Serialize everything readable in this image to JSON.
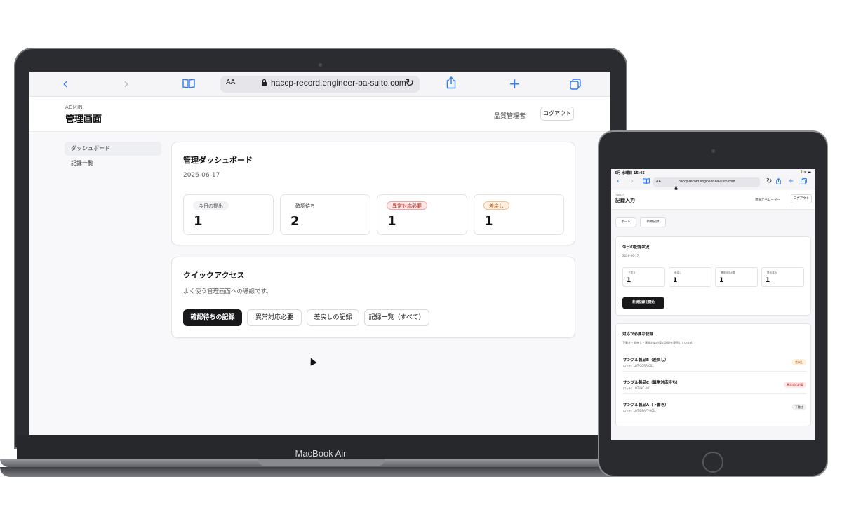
{
  "laptop": {
    "label": "MacBook Air",
    "browser": {
      "text_size": "AA",
      "url": "haccp-record.engineer-ba-sulto.com"
    },
    "header": {
      "eyebrow": "ADMIN",
      "title": "管理画面",
      "user": "品質管理者",
      "logout": "ログアウト"
    },
    "sidebar": {
      "items": [
        {
          "label": "ダッシュボード",
          "active": true
        },
        {
          "label": "記録一覧",
          "active": false
        }
      ]
    },
    "dashboard": {
      "title": "管理ダッシュボード",
      "date": "2026-06-17",
      "stats": [
        {
          "label": "今日の提出",
          "value": "1",
          "bg": "#f2f2f4",
          "fg": "#555555",
          "border": "#f2f2f4"
        },
        {
          "label": "確認待ち",
          "value": "2",
          "bg": "#ffffff",
          "fg": "#333333",
          "border": "#ffffff"
        },
        {
          "label": "異常対応必要",
          "value": "1",
          "bg": "#fde6e6",
          "fg": "#b42318",
          "border": "#f3a3a3"
        },
        {
          "label": "差戻し",
          "value": "1",
          "bg": "#fff0e0",
          "fg": "#b45309",
          "border": "#f5c089"
        }
      ]
    },
    "quick_access": {
      "title": "クイックアクセス",
      "subtitle": "よく使う管理画面への導線です。",
      "buttons": [
        {
          "label": "確認待ちの記録",
          "primary": true
        },
        {
          "label": "異常対応必要",
          "primary": false
        },
        {
          "label": "差戻しの記録",
          "primary": false
        },
        {
          "label": "記録一覧（すべて）",
          "primary": false
        }
      ]
    }
  },
  "tablet": {
    "status": {
      "time": "6月 水曜日 15:45",
      "indicators": "ıl ᯤ ▬"
    },
    "browser": {
      "text_size": "AA",
      "url": "haccp-record.engineer-ba-sulto.com"
    },
    "header": {
      "eyebrow": "TABLET",
      "title": "記録入力",
      "user": "現場オペレーター",
      "logout": "ログアウト"
    },
    "tabs": [
      "ホーム",
      "新規記録"
    ],
    "today": {
      "title": "今日の記録状況",
      "date": "2026-06-17",
      "stats": [
        {
          "label": "下書き",
          "value": "1"
        },
        {
          "label": "差戻し",
          "value": "1"
        },
        {
          "label": "異常対応必要",
          "value": "1"
        },
        {
          "label": "提出済み",
          "value": "1"
        }
      ],
      "start_button": "新規記録を開始"
    },
    "pending": {
      "title": "対応が必要な記録",
      "subtitle": "下書き・差戻し・異常対応必要の記録を表示しています。",
      "rows": [
        {
          "title": "サンプル製品B（差戻し）",
          "lot": "ロット: LOT-CORR-001",
          "badge": "差戻し",
          "bg": "#fff0e0",
          "fg": "#b45309"
        },
        {
          "title": "サンプル製品C（異常対応待ち）",
          "lot": "ロット: LOT-INC-001",
          "badge": "異常対応必要",
          "bg": "#fde6e6",
          "fg": "#b42318"
        },
        {
          "title": "サンプル製品A（下書き）",
          "lot": "ロット: LOT-DRAFT-001",
          "badge": "下書き",
          "bg": "#f0f0f2",
          "fg": "#333333"
        }
      ]
    }
  }
}
